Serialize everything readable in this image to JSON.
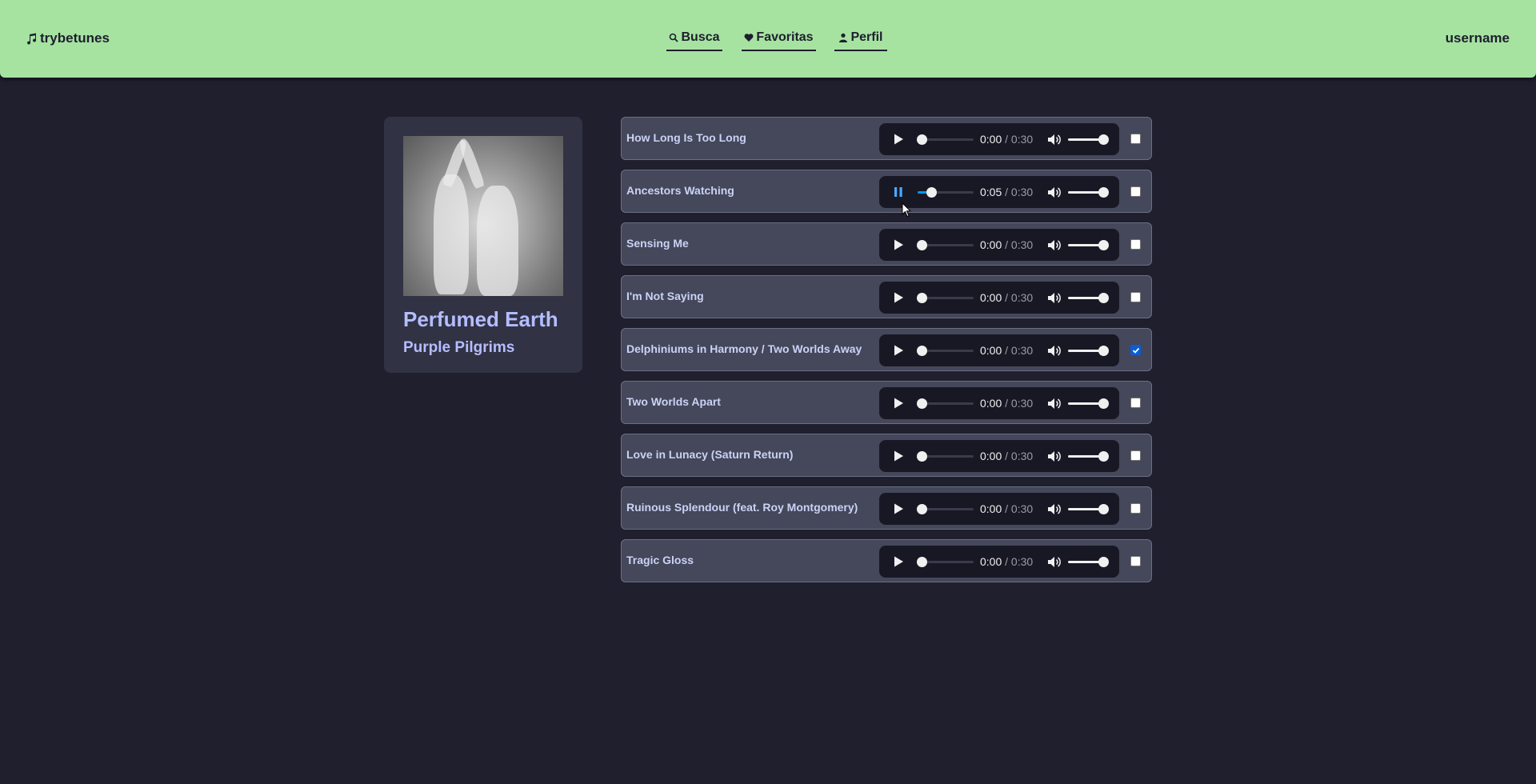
{
  "header": {
    "logo": "trybetunes",
    "nav": [
      {
        "label": "Busca",
        "icon": "search-icon"
      },
      {
        "label": "Favoritas",
        "icon": "heart-icon"
      },
      {
        "label": "Perfil",
        "icon": "user-icon"
      }
    ],
    "username": "username",
    "background": "#a6e3a1"
  },
  "album": {
    "title": "Perfumed Earth",
    "artist": "Purple Pilgrims"
  },
  "tracks": [
    {
      "name": "How Long Is Too Long",
      "current": "0:00",
      "duration": "0:30",
      "playing": false,
      "progress": 0,
      "favorite": false
    },
    {
      "name": "Ancestors Watching",
      "current": "0:05",
      "duration": "0:30",
      "playing": true,
      "progress": 0.17,
      "favorite": false
    },
    {
      "name": "Sensing Me",
      "current": "0:00",
      "duration": "0:30",
      "playing": false,
      "progress": 0,
      "favorite": false
    },
    {
      "name": "I'm Not Saying",
      "current": "0:00",
      "duration": "0:30",
      "playing": false,
      "progress": 0,
      "favorite": false
    },
    {
      "name": "Delphiniums in Harmony / Two Worlds Away",
      "current": "0:00",
      "duration": "0:30",
      "playing": false,
      "progress": 0,
      "favorite": true
    },
    {
      "name": "Two Worlds Apart",
      "current": "0:00",
      "duration": "0:30",
      "playing": false,
      "progress": 0,
      "favorite": false
    },
    {
      "name": "Love in Lunacy (Saturn Return)",
      "current": "0:00",
      "duration": "0:30",
      "playing": false,
      "progress": 0,
      "favorite": false
    },
    {
      "name": "Ruinous Splendour (feat. Roy Montgomery)",
      "current": "0:00",
      "duration": "0:30",
      "playing": false,
      "progress": 0,
      "favorite": false
    },
    {
      "name": "Tragic Gloss",
      "current": "0:00",
      "duration": "0:30",
      "playing": false,
      "progress": 0,
      "favorite": false
    }
  ],
  "volume": 1.0,
  "colors": {
    "page_bg": "#1f1f2e",
    "track_bg": "#45475a",
    "accent_blue": "#0096ff",
    "album_text": "#b4befe"
  }
}
